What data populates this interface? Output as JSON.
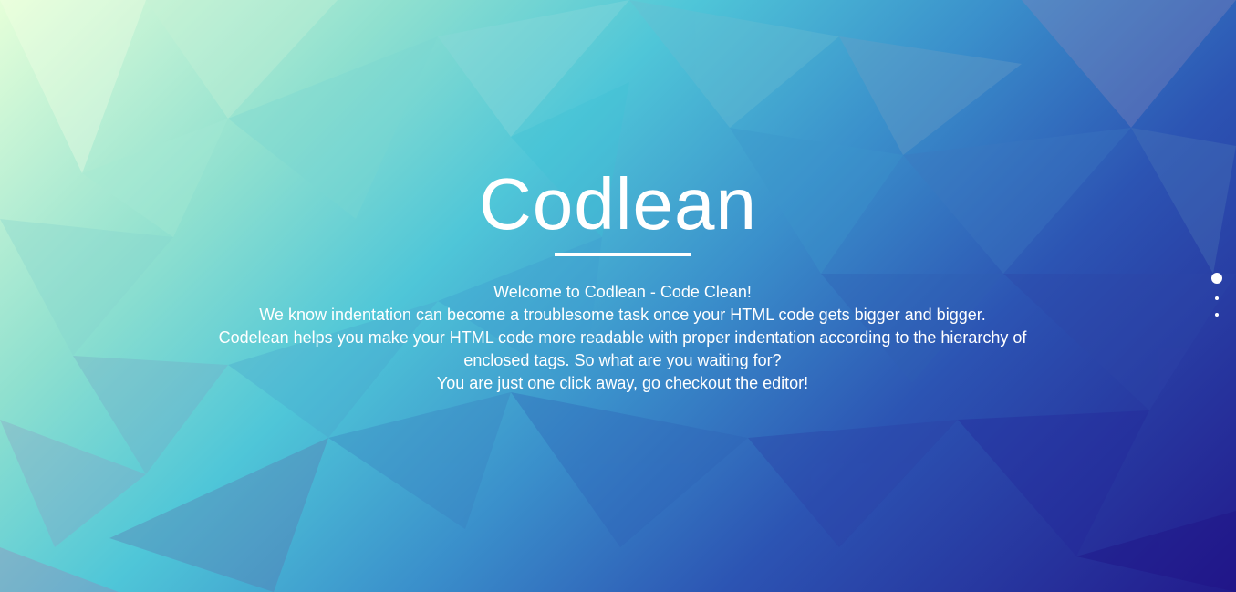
{
  "hero": {
    "title": "Codlean",
    "lines": [
      "Welcome to Codlean - Code Clean!",
      "We know indentation can become a troublesome task once your HTML code gets bigger and bigger.",
      "Codelean helps you make your HTML code more readable with proper indentation according to the hierarchy of enclosed tags. So what are you waiting for?",
      "You are just one click away, go checkout the editor!"
    ]
  },
  "pagination": {
    "count": 3,
    "active_index": 0
  },
  "colors": {
    "text": "#ffffff",
    "gradient_top_left": "#e6ffd9",
    "gradient_mid": "#4fc6d8",
    "gradient_bottom_right": "#221a8c"
  }
}
